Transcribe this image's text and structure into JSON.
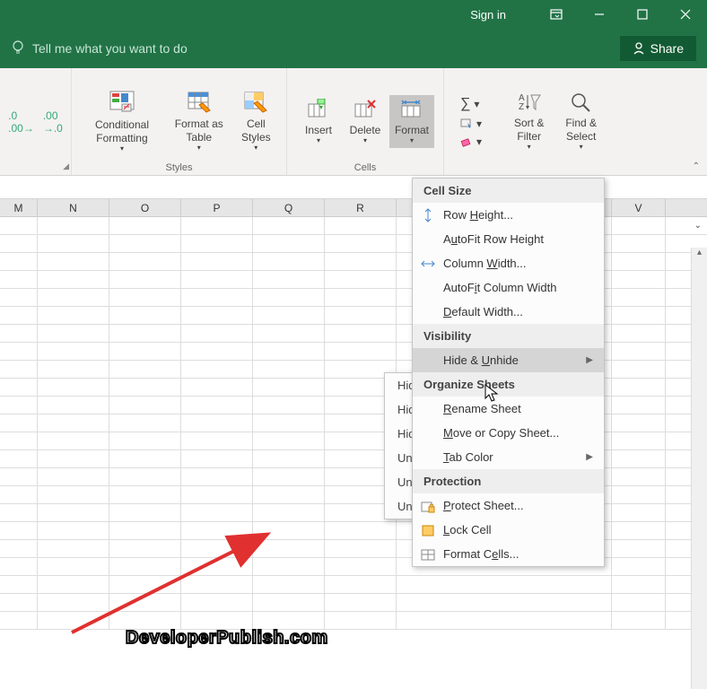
{
  "titlebar": {
    "sign_in": "Sign in"
  },
  "tellme": {
    "placeholder": "Tell me what you want to do",
    "share": "Share"
  },
  "ribbon": {
    "decimal_group_label": "",
    "conditional_formatting": "Conditional Formatting",
    "format_table": "Format as Table",
    "cell_styles": "Cell Styles",
    "styles_label": "Styles",
    "insert": "Insert",
    "delete": "Delete",
    "format": "Format",
    "cells_label": "Cells",
    "sort_filter": "Sort & Filter",
    "find_select": "Find & Select"
  },
  "columns": [
    "M",
    "N",
    "O",
    "P",
    "Q",
    "R",
    "",
    "",
    "",
    "V"
  ],
  "format_menu": {
    "cell_size": "Cell Size",
    "row_height": "Row Height...",
    "autofit_row": "AutoFit Row Height",
    "col_width": "Column Width...",
    "autofit_col": "AutoFit Column Width",
    "default_width": "Default Width...",
    "visibility": "Visibility",
    "hide_unhide": "Hide & Unhide",
    "organize": "Organize Sheets",
    "rename": "Rename Sheet",
    "move_copy": "Move or Copy Sheet...",
    "tab_color": "Tab Color",
    "protection": "Protection",
    "protect_sheet": "Protect Sheet...",
    "lock_cell": "Lock Cell",
    "format_cells": "Format Cells..."
  },
  "submenu": {
    "hide_rows": "Hide Rows",
    "hide_cols": "Hide Columns",
    "hide_sheet": "Hide Sheet",
    "unhide_rows": "Unhide Rows",
    "unhide_cols": "Unhide Columns",
    "unhide_sheet": "Unhide Sheet..."
  },
  "watermark": "DeveloperPublish.com"
}
